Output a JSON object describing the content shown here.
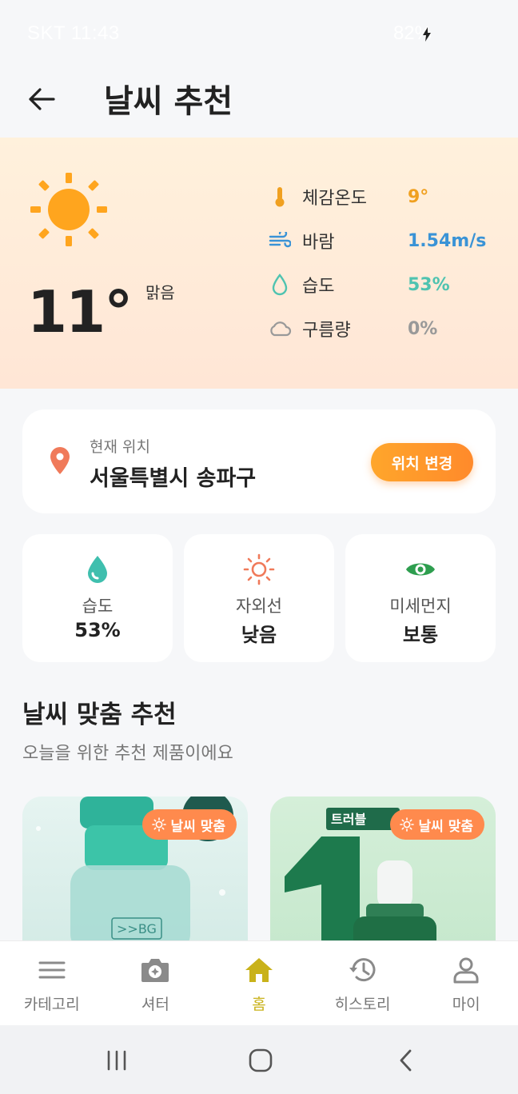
{
  "status_bar": {
    "carrier_time": "SKT 11:43",
    "battery": "82%"
  },
  "app_bar": {
    "title": "날씨 추천"
  },
  "weather": {
    "temperature": "11°",
    "condition": "맑음",
    "metrics": [
      {
        "label": "체감온도",
        "value": "9°",
        "icon": "thermometer-icon",
        "color": "#f0a020"
      },
      {
        "label": "바람",
        "value": "1.54m/s",
        "icon": "wind-icon",
        "color": "#3a93d6"
      },
      {
        "label": "습도",
        "value": "53%",
        "icon": "droplet-icon",
        "color": "#4fc3b0"
      },
      {
        "label": "구름량",
        "value": "0%",
        "icon": "cloud-icon",
        "color": "#999999"
      }
    ]
  },
  "location": {
    "label": "현재 위치",
    "value": "서울특별시 송파구",
    "button": "위치 변경"
  },
  "stats": [
    {
      "label": "습도",
      "value": "53%",
      "icon": "droplet-icon"
    },
    {
      "label": "자외선",
      "value": "낮음",
      "icon": "sun-icon"
    },
    {
      "label": "미세먼지",
      "value": "보통",
      "icon": "eye-icon"
    }
  ],
  "section": {
    "title": "날씨 맞춤 추천",
    "subtitle": "오늘을 위한 추천 제품이에요"
  },
  "products": [
    {
      "badge": "날씨 맞춤",
      "image_text": ">>BG"
    },
    {
      "badge": "날씨 맞춤",
      "image_text": "트러블"
    }
  ],
  "bottom_nav": [
    {
      "label": "카테고리",
      "icon": "menu-icon",
      "active": false
    },
    {
      "label": "셔터",
      "icon": "camera-icon",
      "active": false
    },
    {
      "label": "홈",
      "icon": "home-icon",
      "active": true
    },
    {
      "label": "히스토리",
      "icon": "history-icon",
      "active": false
    },
    {
      "label": "마이",
      "icon": "person-icon",
      "active": false
    }
  ],
  "colors": {
    "accent_orange": "#ff8a2b",
    "active_nav": "#c9b21a",
    "teal": "#4fc3b0"
  }
}
